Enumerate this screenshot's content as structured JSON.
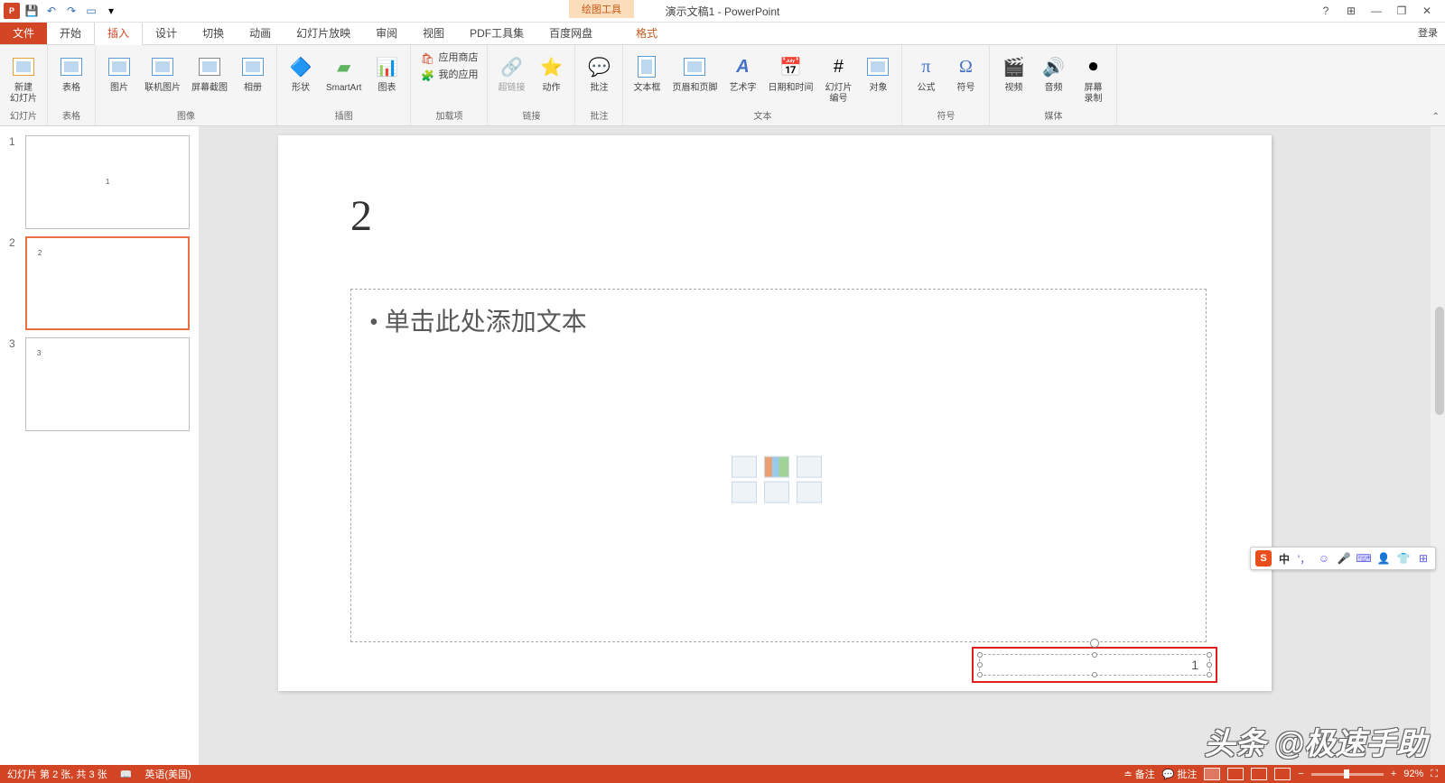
{
  "app": {
    "title": "演示文稿1 - PowerPoint",
    "contextual_tab_group": "绘图工具",
    "login": "登录"
  },
  "qat": {
    "save": "保存",
    "undo": "撤销",
    "redo": "重做",
    "slideshow": "从头开始"
  },
  "win": {
    "help": "?",
    "opts": "⊞",
    "min": "—",
    "restore": "❐",
    "close": "✕"
  },
  "tabs": {
    "file": "文件",
    "home": "开始",
    "insert": "插入",
    "design": "设计",
    "transitions": "切换",
    "animations": "动画",
    "slideshow": "幻灯片放映",
    "review": "审阅",
    "view": "视图",
    "pdf": "PDF工具集",
    "baidu": "百度网盘",
    "format": "格式"
  },
  "ribbon": {
    "groups": {
      "slides": "幻灯片",
      "tables": "表格",
      "images": "图像",
      "illustrations": "插图",
      "addins": "加载项",
      "links": "链接",
      "comments": "批注",
      "text": "文本",
      "symbols": "符号",
      "media": "媒体"
    },
    "buttons": {
      "new_slide": "新建\n幻灯片",
      "table": "表格",
      "pictures": "图片",
      "online_pictures": "联机图片",
      "screenshot": "屏幕截图",
      "photo_album": "相册",
      "shapes": "形状",
      "smartart": "SmartArt",
      "chart": "图表",
      "store": "应用商店",
      "my_addins": "我的应用",
      "hyperlink": "超链接",
      "action": "动作",
      "comment": "批注",
      "text_box": "文本框",
      "header_footer": "页眉和页脚",
      "wordart": "艺术字",
      "date_time": "日期和时间",
      "slide_number": "幻灯片\n编号",
      "object": "对象",
      "equation": "公式",
      "symbol": "符号",
      "video": "视频",
      "audio": "音频",
      "screen_recording": "屏幕\n录制"
    }
  },
  "thumbs": {
    "s1": "1",
    "s2": "2",
    "s3": "3"
  },
  "slide": {
    "title": "2",
    "body_placeholder": "• 单击此处添加文本",
    "page_number": "1"
  },
  "status": {
    "slide_info": "幻灯片 第 2 张, 共 3 张",
    "language": "英语(美国)",
    "notes": "备注",
    "comments": "批注",
    "zoom": "92%"
  },
  "ime": {
    "label": "中"
  },
  "watermark": "头条 @极速手助"
}
